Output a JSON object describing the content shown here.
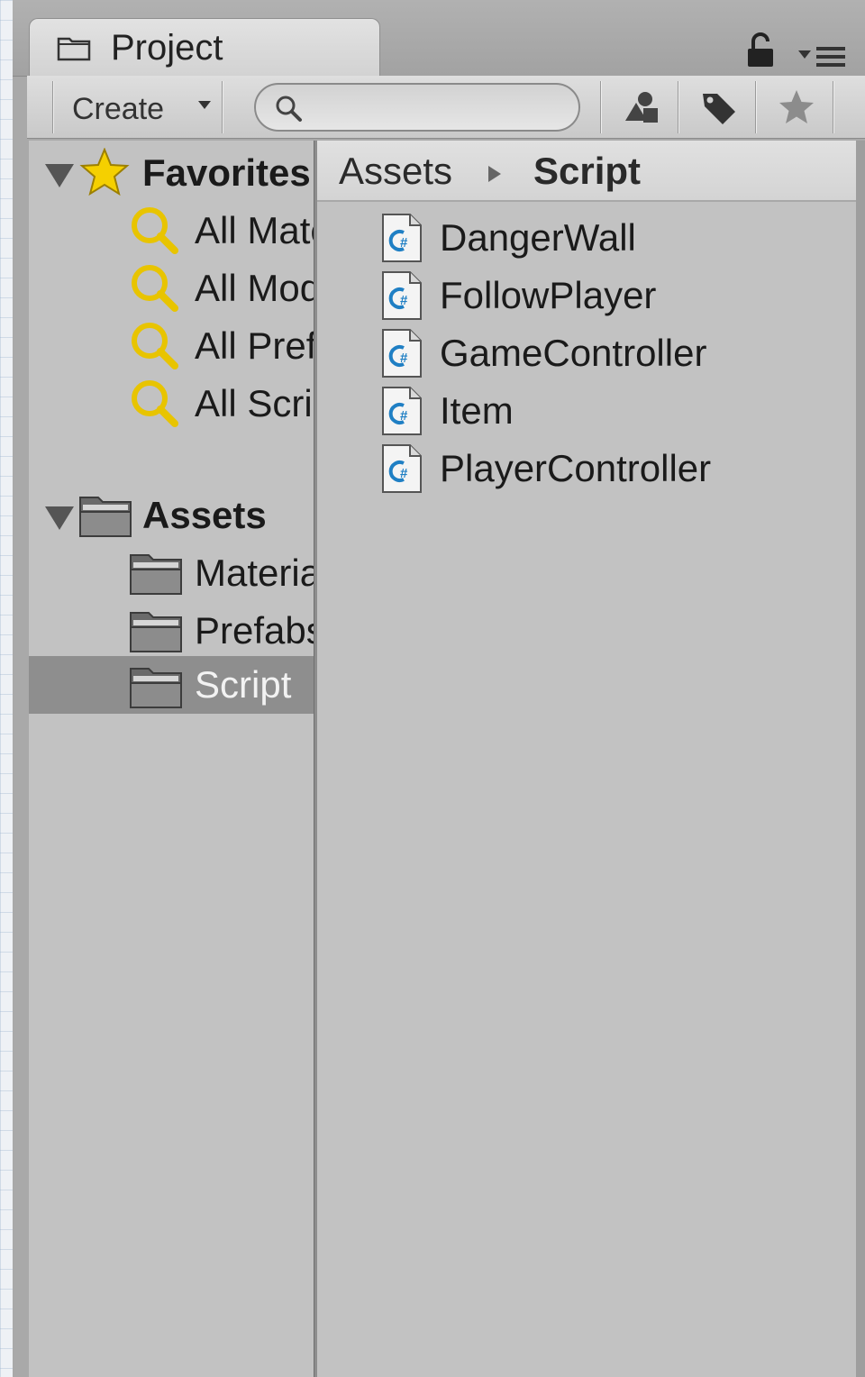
{
  "window": {
    "tab_title": "Project",
    "tab_icon": "folder-icon",
    "lock_icon": "lock-icon",
    "menu_icon": "panel-menu-icon"
  },
  "toolbar": {
    "create_label": "Create",
    "search_placeholder": "",
    "search_value": "",
    "buttons": [
      {
        "icon": "filter-by-type-icon"
      },
      {
        "icon": "filter-by-label-icon"
      },
      {
        "icon": "save-search-star-icon"
      }
    ]
  },
  "tree": {
    "favorites": {
      "label": "Favorites",
      "items": [
        {
          "label": "All Materials"
        },
        {
          "label": "All Models"
        },
        {
          "label": "All Prefabs"
        },
        {
          "label": "All Scripts"
        }
      ]
    },
    "assets": {
      "label": "Assets",
      "items": [
        {
          "label": "Materials"
        },
        {
          "label": "Prefabs"
        },
        {
          "label": "Script",
          "selected": true
        }
      ]
    }
  },
  "content": {
    "breadcrumb": [
      "Assets",
      "Script"
    ],
    "files": [
      {
        "name": "DangerWall",
        "icon": "csharp-script-icon"
      },
      {
        "name": "FollowPlayer",
        "icon": "csharp-script-icon"
      },
      {
        "name": "GameController",
        "icon": "csharp-script-icon"
      },
      {
        "name": "Item",
        "icon": "csharp-script-icon"
      },
      {
        "name": "PlayerController",
        "icon": "csharp-script-icon"
      }
    ]
  },
  "colors": {
    "panel_bg": "#c2c2c2",
    "selection_bg": "#8e8e8e",
    "search_icon_yellow": "#e8c400",
    "star_yellow": "#f5d000",
    "csharp_blue": "#1f7fc4"
  }
}
